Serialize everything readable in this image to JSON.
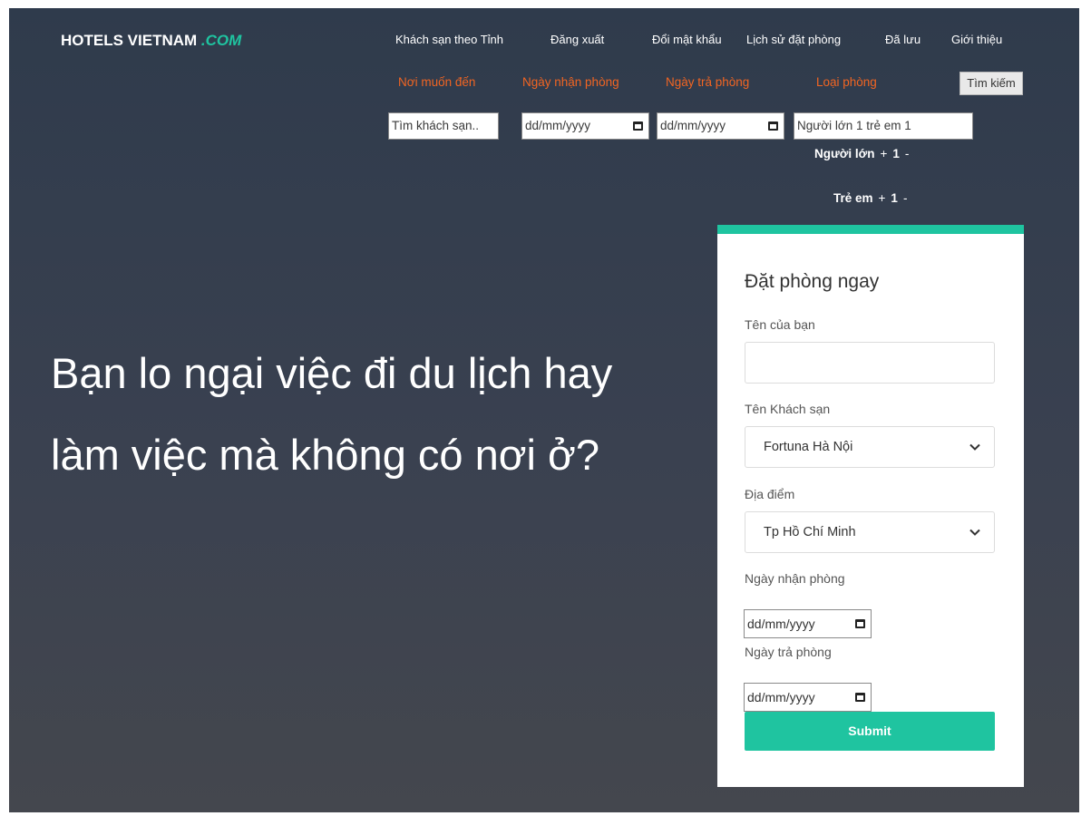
{
  "brand": {
    "name": "HOTELS VIETNAM ",
    "domain": ".COM"
  },
  "nav": [
    {
      "label": "Khách sạn theo Tỉnh"
    },
    {
      "label": "Đăng xuất"
    },
    {
      "label": "Đổi mật khẩu"
    },
    {
      "label": "Lịch sử đặt phòng"
    },
    {
      "label": "Đã lưu"
    },
    {
      "label": "Giới thiệu"
    }
  ],
  "search": {
    "labels": {
      "destination": "Nơi muốn đến",
      "checkin": "Ngày nhận phòng",
      "checkout": "Ngày trả phòng",
      "room_type": "Loại phòng"
    },
    "button": "Tìm kiếm",
    "destination_placeholder": "Tìm khách sạn..",
    "checkin_value": "dd/mm/yyyy",
    "checkout_value": "dd/mm/yyyy",
    "guests_value": "Người lớn 1 trẻ em 1",
    "adults": {
      "label": "Người lớn",
      "plus": "+",
      "value": "1",
      "minus": "-"
    },
    "children": {
      "label": "Trẻ em",
      "plus": "+",
      "value": "1",
      "minus": "-"
    }
  },
  "hero": {
    "headline": "Bạn lo ngại việc đi du lịch hay làm việc mà không có nơi ở?"
  },
  "booking": {
    "title": "Đặt phòng ngay",
    "name_label": "Tên của bạn",
    "name_value": "",
    "hotel_label": "Tên Khách sạn",
    "hotel_value": "Fortuna Hà Nội",
    "location_label": "Địa điểm",
    "location_value": "Tp Hồ Chí Minh",
    "checkin_label": "Ngày nhận phòng",
    "checkin_value": "dd/mm/yyyy",
    "checkout_label": "Ngày trả phòng",
    "checkout_value": "dd/mm/yyyy",
    "submit": "Submit"
  },
  "colors": {
    "accent": "#1fc4a0",
    "search_label": "#f26522",
    "hero_top": "#2f3b4c",
    "hero_bottom": "#44474e"
  },
  "icons": [
    "calendar-icon",
    "chevron-down-icon"
  ]
}
